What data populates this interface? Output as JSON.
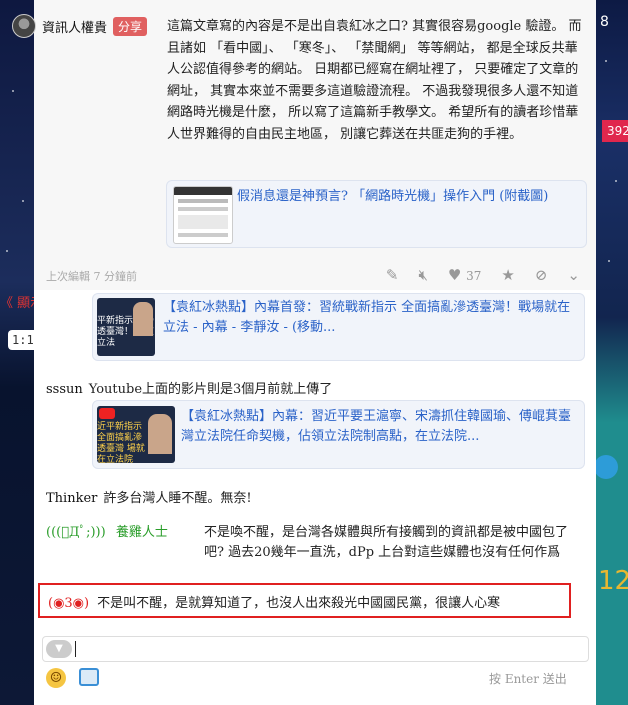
{
  "side": {
    "top_right_num": "8",
    "red_badge": "392",
    "left_red_text": "《 顯示",
    "left_time": "1:1",
    "big_number": "12"
  },
  "post": {
    "author": "資訊人權貴",
    "share_label": "分享",
    "body": "這篇文章寫的內容是不是出自袁紅冰之口? 其實很容易google 驗證。 而且諸如 「看中國」、 「寒冬」、 「禁聞網」 等等網站， 都是全球反共華人公認值得參考的網站。 日期都已經寫在網址裡了， 只要確定了文章的網址， 其實本來並不需要多這道驗證流程。 不過我發現很多人還不知道網路時光機是什麼， 所以寫了這篇新手教學文。 希望所有的讀者珍惜華人世界難得的自由民主地區， 別讓它葬送在共匪走狗的手裡。",
    "link_title": "假消息還是神預言? 「網路時光機」操作入門 (附截圖)",
    "edited": "上次編輯 7 分鐘前",
    "like_count": "37",
    "colors": {
      "link": "#2a62c8",
      "share_bg": "#e06060"
    }
  },
  "comments": [
    {
      "link_title": "【袁紅冰熱點】內幕首發：習統戰新指示 全面搞亂滲透臺灣！戰場就在立法 - 內幕 - 李靜汝 - (移動...",
      "thumb_caption": "平新指示 亂滲透臺灣！ 就在立法"
    },
    {
      "name": "sssun",
      "text": "Youtube上面的影片則是3個月前就上傳了",
      "link_title": "【袁紅冰熱點】內幕：習近平要王滬寧、宋濤抓住韓國瑜、傅崐萁臺灣立法院任命契機，佔領立法院制高點，在立法院...",
      "thumb_caption": "近平新指示 全面搞亂滲透臺灣 場就在立法院"
    },
    {
      "name": "Thinker",
      "text": "許多台灣人睡不醒。無奈!"
    },
    {
      "name": "(((ﾟДﾟ;)))",
      "name2": "養雞人士",
      "text": "不是喚不醒，是台灣各媒體與所有接觸到的資訊都是被中國包了吧? 過去20幾年一直洗，dPp 上台對這些媒體也沒有任何作爲"
    },
    {
      "name": "(◉3◉)",
      "text": "不是叫不醒，是就算知道了，也沒人出來殺光中國國民黨，很讓人心寒"
    }
  ],
  "input": {
    "hint": "按 Enter 送出"
  }
}
